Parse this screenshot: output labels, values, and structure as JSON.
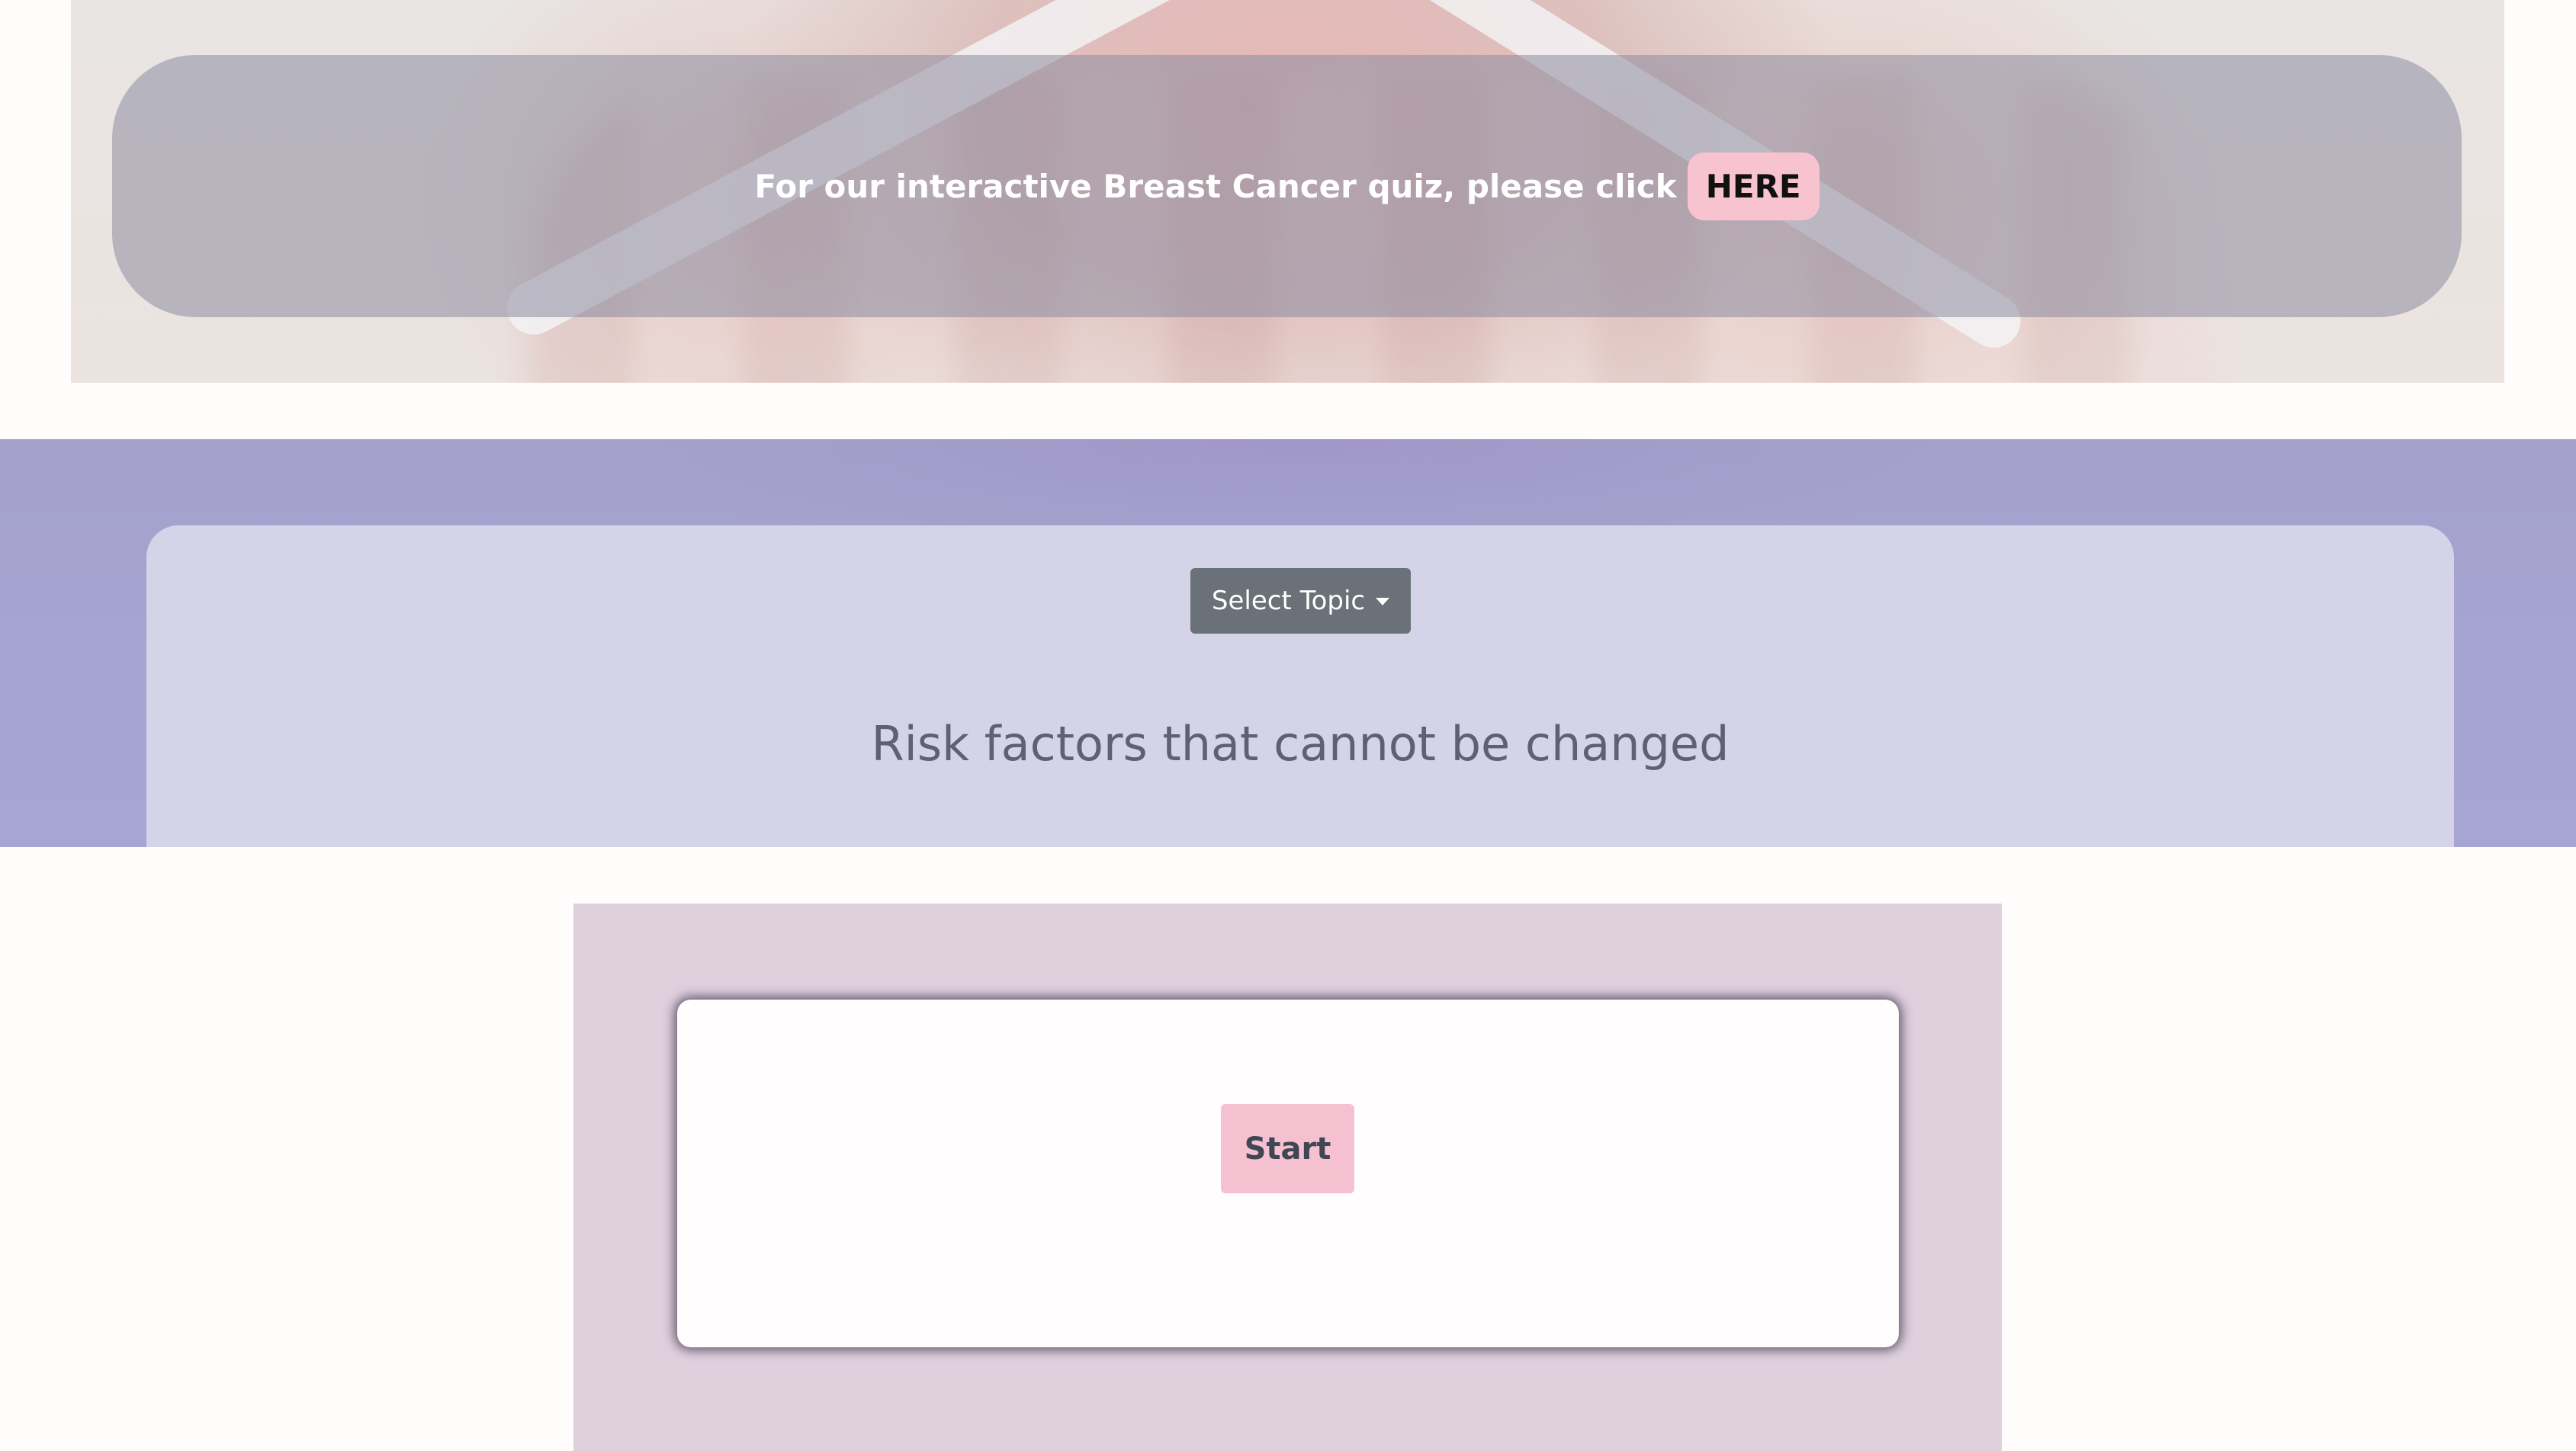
{
  "hero": {
    "banner_text": "For our interactive Breast Cancer quiz, please click",
    "here_label": "HERE"
  },
  "topic": {
    "dropdown_label": "Select Topic",
    "title": "Risk factors that cannot be changed"
  },
  "quiz": {
    "start_label": "Start"
  },
  "colors": {
    "accent_pink": "#f5c0d0",
    "band_purple": "#a7a5d4",
    "card_lavender": "#d4d3e8",
    "dropdown_gray": "#6b7178",
    "quiz_bg": "#dfd0de"
  },
  "icons": {
    "dropdown": "caret-down-icon"
  }
}
